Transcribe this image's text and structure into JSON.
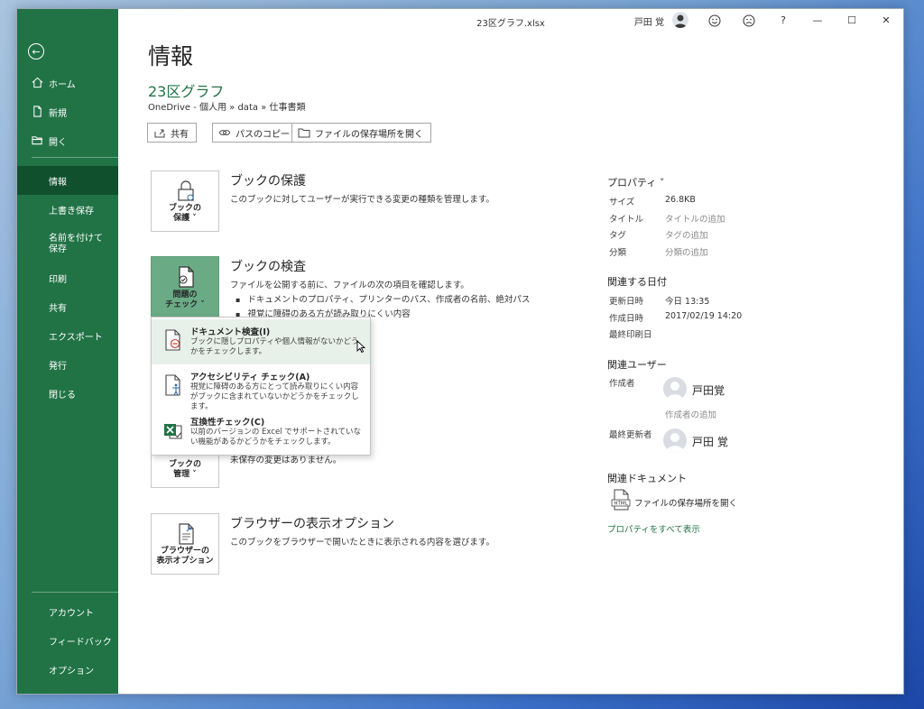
{
  "window": {
    "title": "23区グラフ.xlsx",
    "user": "戸田 覚"
  },
  "sidebar": {
    "back_icon": "back-arrow-icon",
    "items": [
      {
        "label": "ホーム",
        "icon": "home-icon"
      },
      {
        "label": "新規",
        "icon": "new-file-icon"
      },
      {
        "label": "開く",
        "icon": "open-folder-icon"
      },
      {
        "label": "情報",
        "active": true
      },
      {
        "label": "上書き保存"
      },
      {
        "label": "名前を付けて保存"
      },
      {
        "label": "印刷"
      },
      {
        "label": "共有"
      },
      {
        "label": "エクスポート"
      },
      {
        "label": "発行"
      },
      {
        "label": "閉じる"
      }
    ],
    "bottom_items": [
      {
        "label": "アカウント"
      },
      {
        "label": "フィードバック"
      },
      {
        "label": "オプション"
      }
    ]
  },
  "main": {
    "page_title": "情報",
    "file_name": "23区グラフ",
    "breadcrumb": "OneDrive - 個人用 » data » 仕事書類",
    "actions": [
      "共有",
      "パスのコピー",
      "ファイルの保存場所を開く"
    ],
    "sections": [
      {
        "tile_line1": "ブックの",
        "tile_line2": "保護 ˅",
        "title": "ブックの保護",
        "desc": "このブックに対してユーザーが実行できる変更の種類を管理します。"
      },
      {
        "tile_line1": "問題の",
        "tile_line2": "チェック ˅",
        "title": "ブックの検査",
        "desc": "ファイルを公開する前に、ファイルの次の項目を確認します。",
        "bullets": [
          "ドキュメントのプロパティ、プリンターのパス、作成者の名前、絶対パス",
          "視覚に障碍のある方が読み取りにくい内容"
        ]
      },
      {
        "tile_line1": "ブックの",
        "tile_line2": "管理 ˅",
        "desc_partial": "未保存の変更はありません。"
      },
      {
        "tile_line1": "ブラウザーの",
        "tile_line2": "表示オプション",
        "title": "ブラウザーの表示オプション",
        "desc": "このブックをブラウザーで開いたときに表示される内容を選びます。"
      }
    ],
    "dropdown": [
      {
        "title": "ドキュメント検査(I)",
        "desc": "ブックに隠しプロパティや個人情報がないかどうかをチェックします。"
      },
      {
        "title": "アクセシビリティ チェック(A)",
        "desc": "視覚に障碍のある方にとって読み取りにくい内容がブックに含まれていないかどうかをチェックします。"
      },
      {
        "title": "互換性チェック(C)",
        "desc": "以前のバージョンの Excel でサポートされていない機能があるかどうかをチェックします。"
      }
    ]
  },
  "properties": {
    "heading": "プロパティ ˅",
    "rows": [
      {
        "key": "サイズ",
        "value": "26.8KB"
      },
      {
        "key": "タイトル",
        "value": "タイトルの追加"
      },
      {
        "key": "タグ",
        "value": "タグの追加"
      },
      {
        "key": "分類",
        "value": "分類の追加"
      }
    ],
    "dates_heading": "関連する日付",
    "dates": [
      {
        "key": "更新日時",
        "value": "今日 13:35"
      },
      {
        "key": "作成日時",
        "value": "2017/02/19 14:20"
      },
      {
        "key": "最終印刷日",
        "value": ""
      }
    ],
    "users_heading": "関連ユーザー",
    "author_label": "作成者",
    "author_name": "戸田覚",
    "add_author": "作成者の追加",
    "last_modified_label": "最終更新者",
    "last_modified_name": "戸田 覚",
    "docs_heading": "関連ドキュメント",
    "open_location": "ファイルの保存場所を開く",
    "show_all": "プロパティをすべて表示"
  }
}
